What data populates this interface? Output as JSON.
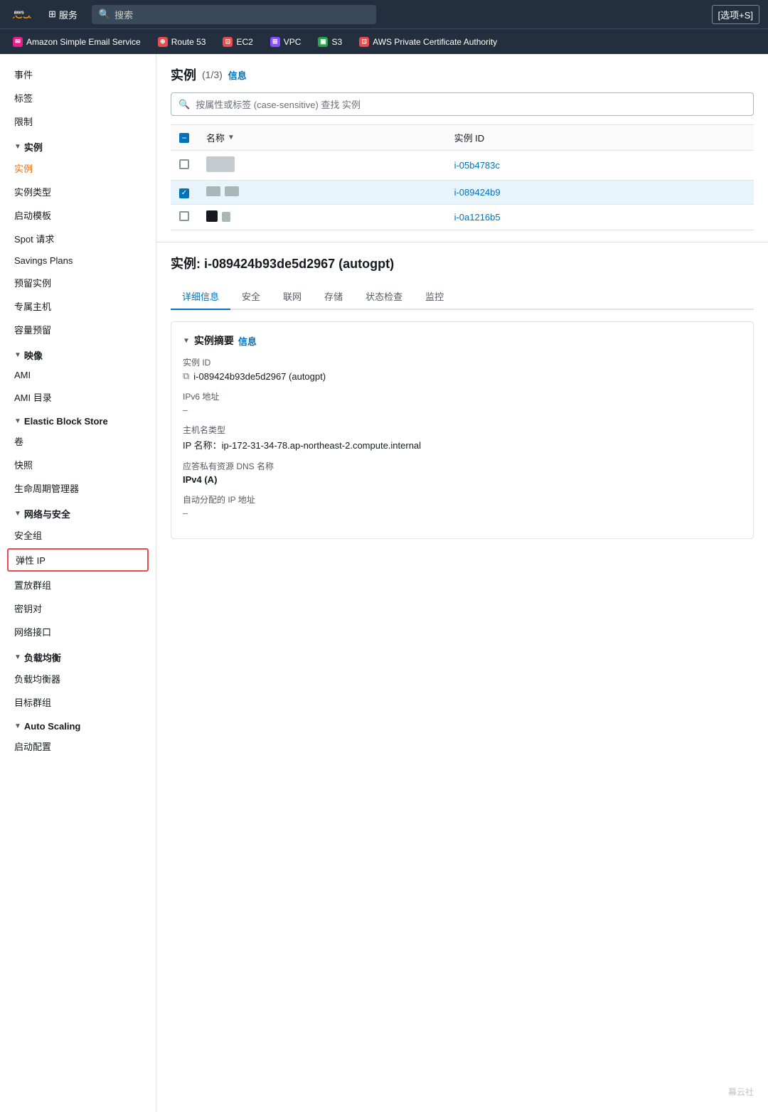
{
  "topnav": {
    "search_placeholder": "搜索",
    "options_label": "[选项+S]",
    "services_label": "服务"
  },
  "service_tabs": [
    {
      "id": "ses",
      "label": "Amazon Simple Email Service",
      "color": "#e91e8c",
      "icon": "✉"
    },
    {
      "id": "route53",
      "label": "Route 53",
      "color": "#e84c4c",
      "icon": "⊕"
    },
    {
      "id": "ec2",
      "label": "EC2",
      "color": "#e84c4c",
      "icon": "⊡"
    },
    {
      "id": "vpc",
      "label": "VPC",
      "color": "#8c4fff",
      "icon": "⊞"
    },
    {
      "id": "s3",
      "label": "S3",
      "color": "#2da34d",
      "icon": "▣"
    },
    {
      "id": "acm",
      "label": "AWS Private Certificate Authority",
      "color": "#e84c4c",
      "icon": "⊡"
    }
  ],
  "sidebar": {
    "top_items": [
      "事件",
      "标签",
      "限制"
    ],
    "sections": [
      {
        "title": "实例",
        "items": [
          "实例",
          "实例类型",
          "启动模板",
          "Spot 请求",
          "Savings Plans",
          "预留实例",
          "专属主机",
          "容量预留"
        ],
        "active_item": "实例"
      },
      {
        "title": "映像",
        "items": [
          "AMI",
          "AMI 目录"
        ]
      },
      {
        "title": "Elastic Block Store",
        "items": [
          "卷",
          "快照",
          "生命周期管理器"
        ]
      },
      {
        "title": "网络与安全",
        "items": [
          "安全组",
          "弹性 IP",
          "置放群组",
          "密钥对",
          "网络接口"
        ],
        "highlighted_item": "弹性 IP"
      },
      {
        "title": "负载均衡",
        "items": [
          "负载均衡器",
          "目标群组"
        ]
      },
      {
        "title": "Auto Scaling",
        "items": [
          "启动配置"
        ]
      }
    ]
  },
  "instances_panel": {
    "title": "实例",
    "count": "(1/3)",
    "info_label": "信息",
    "search_placeholder": "按属性或标签 (case-sensitive) 查找 实例",
    "columns": [
      {
        "id": "name",
        "label": "名称"
      },
      {
        "id": "instance_id",
        "label": "实例 ID"
      }
    ],
    "rows": [
      {
        "id": "row1",
        "checked": false,
        "instance_id": "i-05b4783c",
        "instance_id_full": "i-05b4783c..."
      },
      {
        "id": "row2",
        "checked": true,
        "instance_id": "i-089424b9",
        "instance_id_full": "i-089424b9..."
      },
      {
        "id": "row3",
        "checked": false,
        "instance_id": "i-0a1216b5",
        "instance_id_full": "i-0a1216b5..."
      }
    ]
  },
  "detail_panel": {
    "title": "实例: i-089424b93de5d2967 (autogpt)",
    "tabs": [
      "详细信息",
      "安全",
      "联网",
      "存储",
      "状态检查",
      "监控"
    ],
    "active_tab": "详细信息",
    "summary": {
      "header": "实例摘要",
      "info_label": "信息",
      "fields": [
        {
          "label": "实例 ID",
          "value": "i-089424b93de5d2967 (autogpt)",
          "has_copy": true
        },
        {
          "label": "IPv6 地址",
          "value": "–",
          "is_dash": true
        },
        {
          "label": "主机名类型",
          "value": "IP 名称：ip-172-31-34-78.ap-northeast-2.compute.internal"
        },
        {
          "label": "应答私有资源 DNS 名称",
          "value": "IPv4 (A)",
          "is_bold": true
        },
        {
          "label": "自动分配的 IP 地址",
          "value": "–",
          "is_dash": true
        }
      ]
    }
  },
  "watermark": "幕云社"
}
